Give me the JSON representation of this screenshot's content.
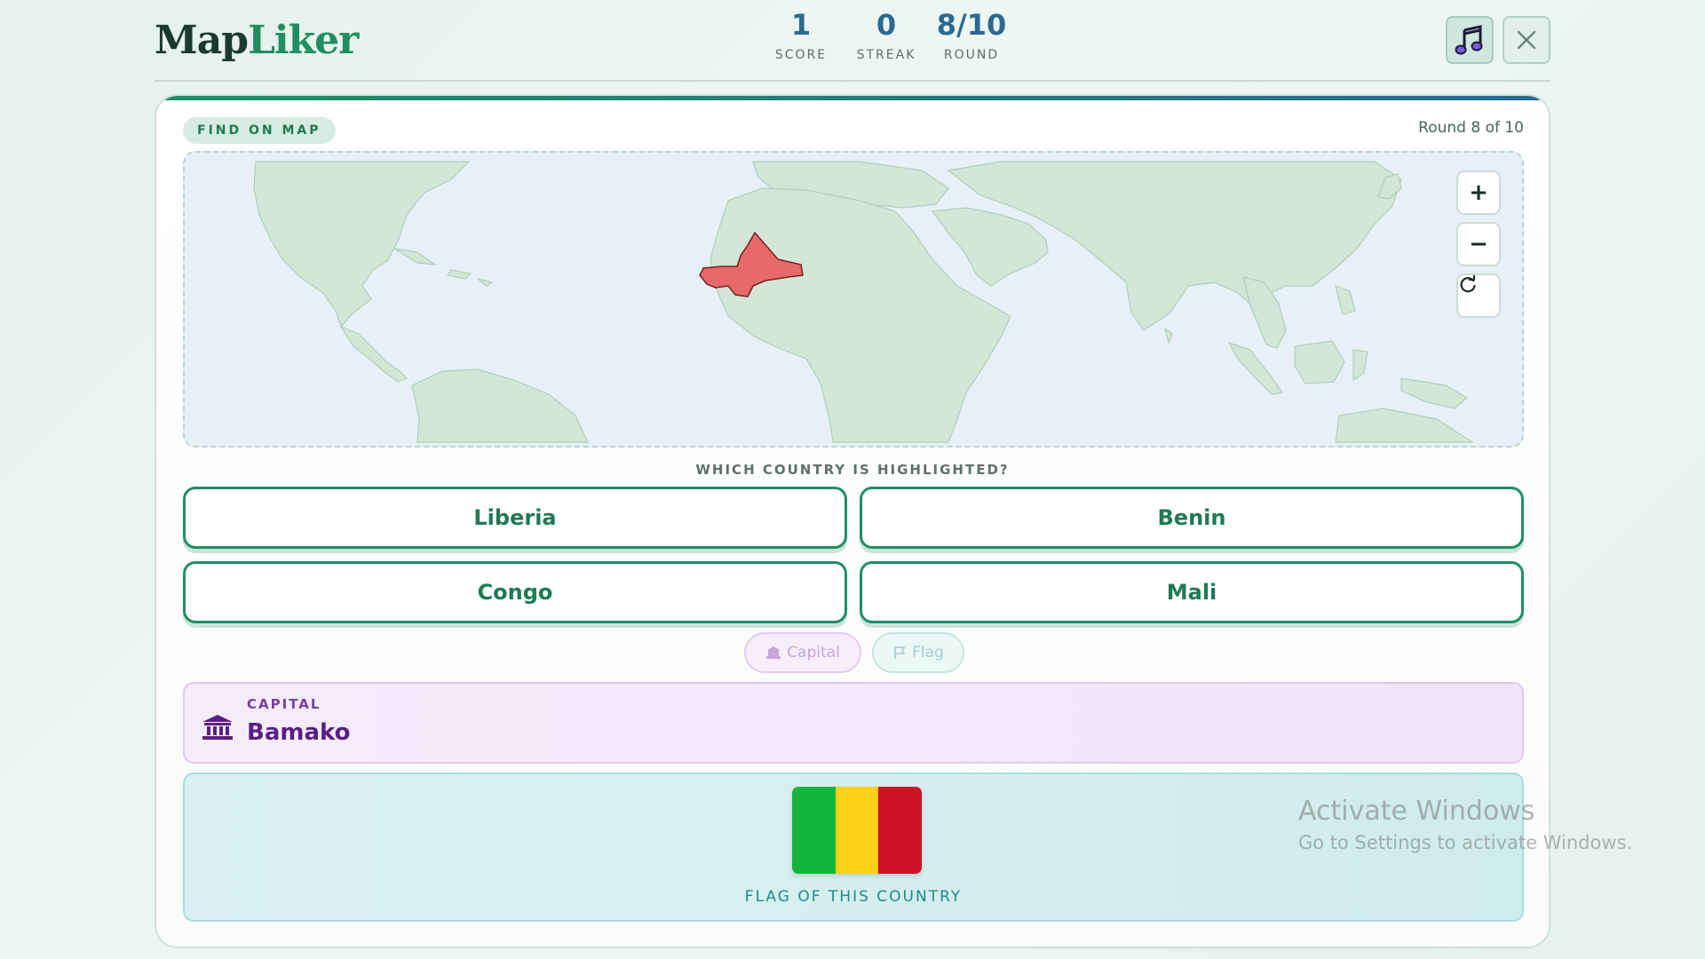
{
  "header": {
    "logo_part1": "Map",
    "logo_part2": "Liker",
    "stats": [
      {
        "value": "1",
        "label": "SCORE"
      },
      {
        "value": "0",
        "label": "STREAK"
      },
      {
        "value": "8/10",
        "label": "ROUND"
      }
    ],
    "music_icon": "music-note-icon",
    "close_icon": "close-icon"
  },
  "card": {
    "mode_badge": "FIND ON MAP",
    "round_text": "Round 8 of 10",
    "map": {
      "highlight_color": "#e66a6a",
      "land_color": "#d3e6d8",
      "ocean_color": "#e7f0f6",
      "zoom_in_label": "+",
      "zoom_out_label": "−",
      "reset_icon": "refresh-icon"
    },
    "question": "WHICH COUNTRY IS HIGHLIGHTED?",
    "answers": [
      "Liberia",
      "Benin",
      "Congo",
      "Mali"
    ],
    "hints": {
      "capital_label": "Capital",
      "flag_label": "Flag"
    },
    "capital_panel": {
      "label": "CAPITAL",
      "value": "Bamako",
      "icon": "building-icon"
    },
    "flag_panel": {
      "caption": "FLAG OF THIS COUNTRY",
      "colors": [
        "#14b53a",
        "#fcd116",
        "#ce1126"
      ]
    }
  },
  "watermark": {
    "title": "Activate Windows",
    "subtitle": "Go to Settings to activate Windows."
  }
}
